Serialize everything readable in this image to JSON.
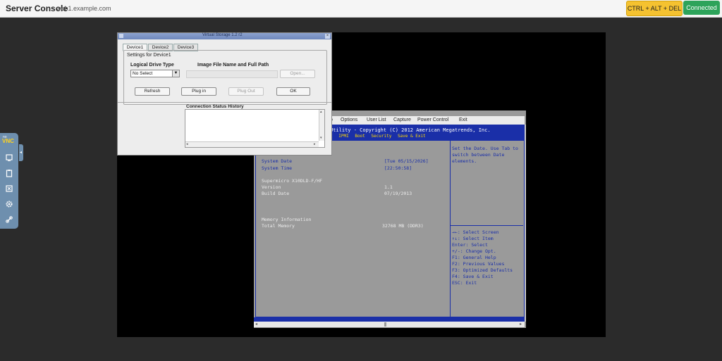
{
  "app": {
    "title": "Server Console",
    "host": "web1.example.com"
  },
  "toolbar": {
    "cad_label": "CTRL + ALT + DEL",
    "status_label": "Connected"
  },
  "novnc": {
    "logo_top": "no",
    "logo": "VNC",
    "handle": "◂"
  },
  "bios": {
    "menubar": [
      "o",
      "Options",
      "User List",
      "Capture",
      "Power Control",
      "Exit"
    ],
    "copyright": "Utility - Copyright (C) 2012 American Megatrends, Inc.",
    "tabs": [
      "t",
      "IPMI",
      "Boot",
      "Security",
      "Save & Exit"
    ],
    "fields": [
      {
        "label": "System Date",
        "value": "[Tue 05/15/2026]"
      },
      {
        "label": "System Time",
        "value": "[22:50:58]"
      },
      {
        "label": "Supermicro X10DLD-F/HF",
        "value": ""
      },
      {
        "label": "Version",
        "value": "1.1"
      },
      {
        "label": "Build Date",
        "value": "07/19/2013"
      },
      {
        "label": "Memory Information",
        "value": ""
      },
      {
        "label": "Total Memory",
        "value": "32768 MB (DDR3)"
      }
    ],
    "help": [
      "Set the Date. Use Tab to",
      "switch between Date",
      "elements."
    ],
    "keys": [
      "→←: Select Screen",
      "↑↓: Select Item",
      "Enter: Select",
      "+/-: Change Opt.",
      "F1: General Help",
      "F2: Previous Values",
      "F3: Optimized Defaults",
      "F4: Save & Exit",
      "ESC: Exit"
    ]
  },
  "vs": {
    "title": "Virtual Storage 1.2 r2",
    "close": "×",
    "tabs": [
      "Device1",
      "Device2",
      "Device3"
    ],
    "group_title": "Settings for Device1",
    "drive_type_label": "Logical Drive Type",
    "image_label": "Image File Name and Full Path",
    "drive_type_value": "No Select",
    "open_label": "Open...",
    "buttons": {
      "refresh": "Refresh",
      "plug_in": "Plug in",
      "plug_out": "Plug Out",
      "ok": "OK"
    },
    "history_label": "Connection Status History"
  }
}
